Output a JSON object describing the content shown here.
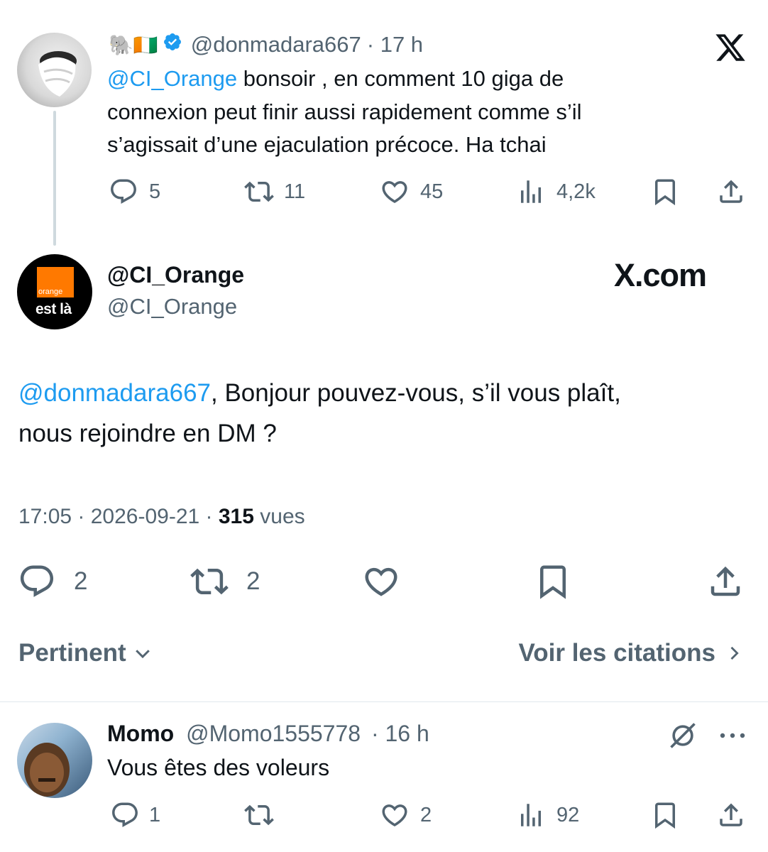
{
  "parent_tweet": {
    "emojis": "🐘🇨🇮",
    "handle": "@donmadara667",
    "time": "· 17 h",
    "mention": "@CI_Orange",
    "text_line1": " bonsoir , en comment 10 giga de",
    "text_line2": "connexion peut finir aussi rapidement comme s’il",
    "text_line3": "s’agissait d’une ejaculation précoce. Ha tchai",
    "replies": "5",
    "retweets": "11",
    "likes": "45",
    "views": "4,2k"
  },
  "main_tweet": {
    "name": "@CI_Orange",
    "handle": "@CI_Orange",
    "avatar_text_top": "orange",
    "avatar_text_bottom": "est là",
    "mention": "@donmadara667",
    "text_line1_rest": ", Bonjour pouvez-vous, s’il vous plaît,",
    "text_line2": "nous rejoindre en DM ?",
    "timestamp": "17:05 · 2026-09-21 · ",
    "views_count": "315",
    "views_label": " vues",
    "replies": "2",
    "retweets": "2"
  },
  "brand": {
    "x_logo": "X",
    "watermark": "X.com"
  },
  "sort": {
    "label": "Pertinent",
    "quotes_link": "Voir les citations"
  },
  "reply": {
    "name": "Momo",
    "handle": "@Momo1555778",
    "time": "· 16 h",
    "text": "Vous êtes des voleurs",
    "replies": "1",
    "retweets": "",
    "likes": "2",
    "views": "92"
  },
  "colors": {
    "accent": "#1d9bf0",
    "secondary_text": "#536471",
    "verified": "#1d9bf0",
    "orange_brand": "#ff7900"
  }
}
